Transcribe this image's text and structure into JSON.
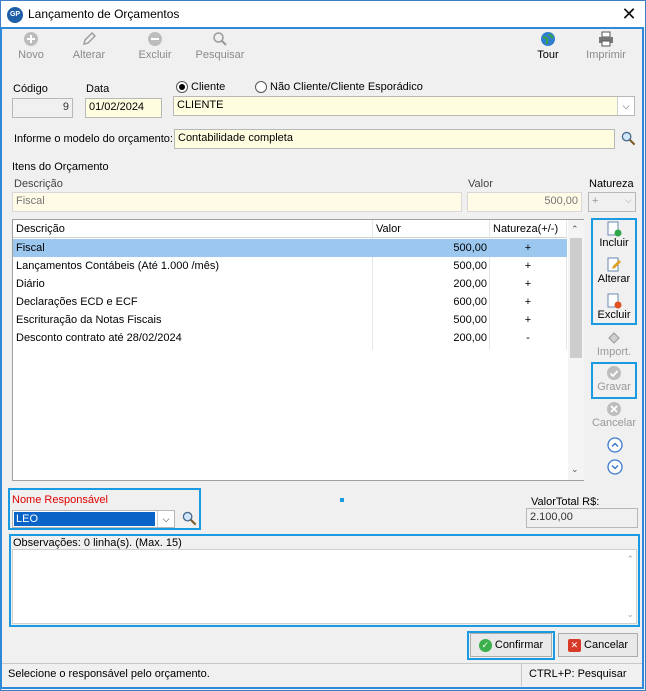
{
  "window": {
    "title": "Lançamento de Orçamentos",
    "app_icon_text": "GP"
  },
  "toolbar": {
    "novo": "Novo",
    "alterar": "Alterar",
    "excluir": "Excluir",
    "pesquisar": "Pesquisar",
    "tour": "Tour",
    "imprimir": "Imprimir"
  },
  "form": {
    "codigo_label": "Código",
    "codigo_value": "9",
    "data_label": "Data",
    "data_value": "01/02/2024",
    "radio_cliente": "Cliente",
    "radio_nao_cliente": "Não Cliente/Cliente Esporádico",
    "cliente_value": "CLIENTE",
    "modelo_label": "Informe o modelo do orçamento:",
    "modelo_value": "Contabilidade completa"
  },
  "itens": {
    "section_label": "Itens do Orçamento",
    "descricao_label": "Descrição",
    "descricao_value": "Fiscal",
    "valor_label": "Valor",
    "valor_value": "500,00",
    "natureza_label": "Natureza",
    "natureza_value": "+"
  },
  "grid": {
    "headers": [
      "Descrição",
      "Valor",
      "Natureza(+/-)"
    ],
    "rows": [
      {
        "descricao": "Fiscal",
        "valor": "500,00",
        "natureza": "+"
      },
      {
        "descricao": "Lançamentos Contábeis (Até 1.000 /mês)",
        "valor": "500,00",
        "natureza": "+"
      },
      {
        "descricao": "Diário",
        "valor": "200,00",
        "natureza": "+"
      },
      {
        "descricao": "Declarações ECD e ECF",
        "valor": "600,00",
        "natureza": "+"
      },
      {
        "descricao": "Escrituração da Notas Fiscais",
        "valor": "500,00",
        "natureza": "+"
      },
      {
        "descricao": "Desconto contrato até 28/02/2024",
        "valor": "200,00",
        "natureza": "-"
      }
    ]
  },
  "side": {
    "incluir": "Incluir",
    "alterar": "Alterar",
    "excluir": "Excluir",
    "import": "Import.",
    "gravar": "Gravar",
    "cancelar": "Cancelar"
  },
  "responsavel": {
    "label": "Nome Responsável",
    "value": "LEO",
    "label_color": "#e00000"
  },
  "total": {
    "label": "ValorTotal R$:",
    "value": "2.100,00"
  },
  "obs": {
    "label": "Observações:  0 linha(s). (Max. 15)"
  },
  "buttons": {
    "confirmar": "Confirmar",
    "cancelar": "Cancelar"
  },
  "status": {
    "message": "Selecione o responsável pelo orçamento.",
    "shortcut": "CTRL+P: Pesquisar"
  },
  "colors": {
    "highlight": "#1a9ae0",
    "selection": "#9cc8f0",
    "input_bg": "#fffde0"
  }
}
